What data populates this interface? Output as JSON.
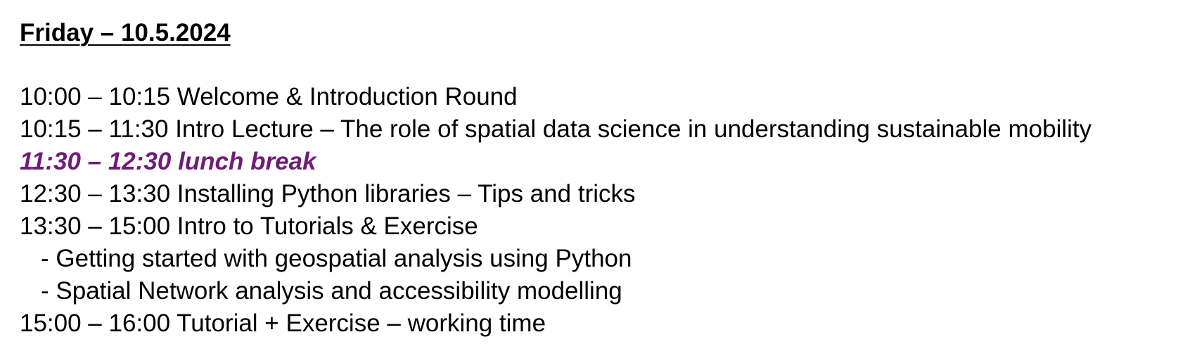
{
  "document": {
    "title": "Friday – 10.5.2024",
    "colors": {
      "text": "#000000",
      "break": "#6f1c78",
      "background": "#ffffff"
    },
    "schedule": [
      "10:00 – 10:15 Welcome & Introduction Round",
      "10:15 – 11:30 Intro Lecture – The role of spatial data science in understanding sustainable mobility",
      "11:30 – 12:30 lunch break",
      "12:30 – 13:30 Installing Python libraries – Tips and tricks",
      "13:30 – 15:00 Intro to Tutorials & Exercise",
      "- Getting started with geospatial analysis using Python",
      "- Spatial Network analysis and accessibility modelling",
      "15:00 – 16:00 Tutorial + Exercise – working time"
    ]
  }
}
